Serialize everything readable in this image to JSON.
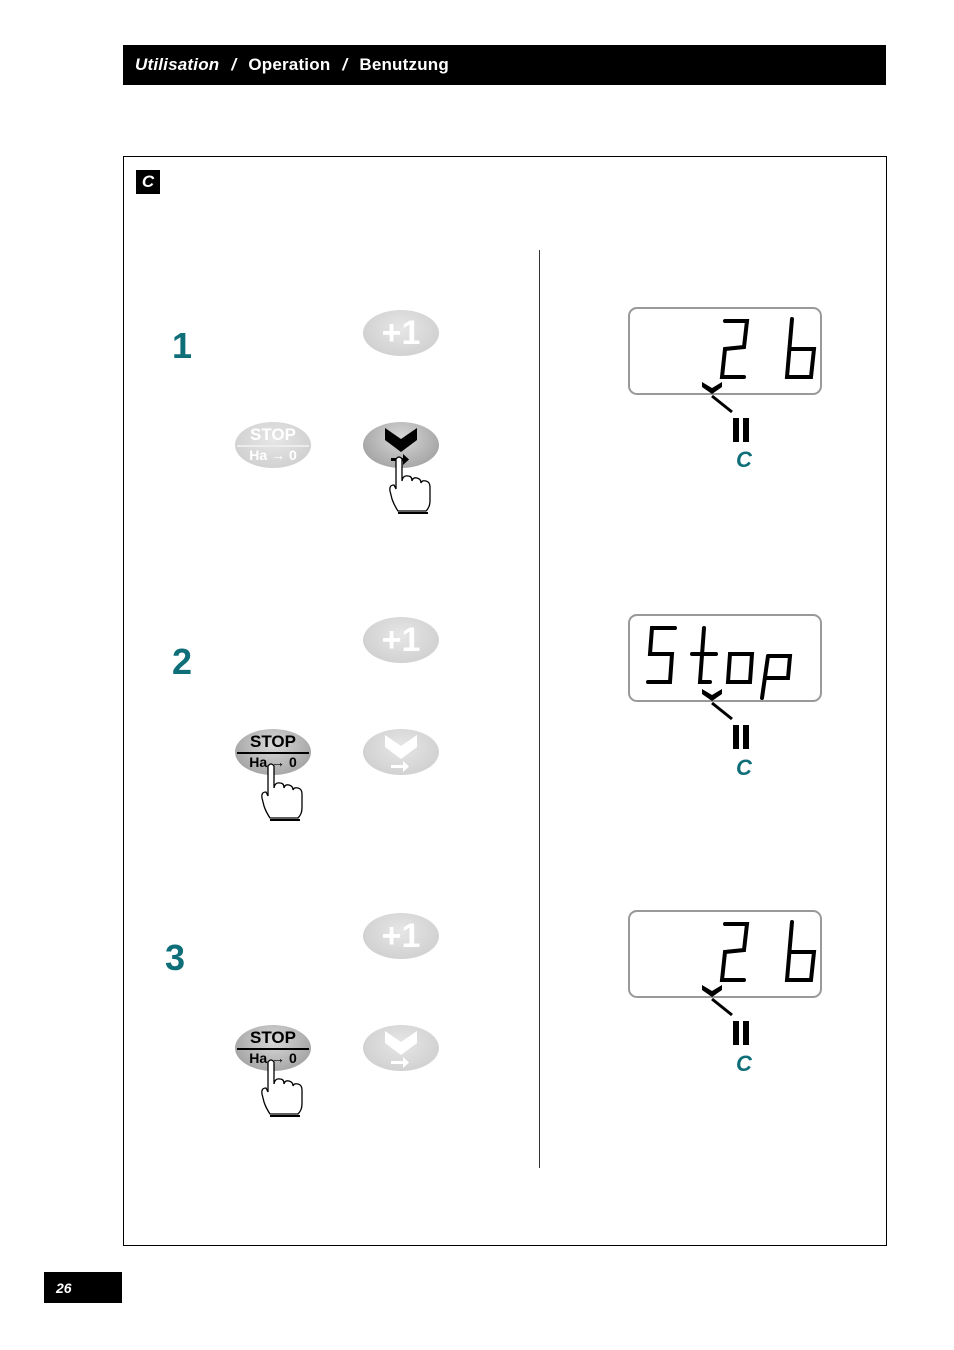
{
  "header": {
    "title_fr": "Utilisation",
    "separator": "/",
    "title_en": "Operation",
    "title_de": "Benutzung"
  },
  "section": {
    "badge": "C"
  },
  "steps": [
    {
      "number": "1",
      "plus_button": {
        "label": "+1",
        "state": "inactive"
      },
      "stop_button": {
        "top_label": "STOP",
        "bottom_label": "Ha → 0",
        "state": "inactive"
      },
      "select_button": {
        "icon": "chevron-down-arrow-icon",
        "state": "pressed"
      },
      "pressed_button": "select",
      "display": {
        "text": "2 b",
        "indicator": "C"
      }
    },
    {
      "number": "2",
      "plus_button": {
        "label": "+1",
        "state": "inactive"
      },
      "stop_button": {
        "top_label": "STOP",
        "bottom_label": "Ha → 0",
        "state": "pressed"
      },
      "select_button": {
        "icon": "chevron-down-arrow-icon",
        "state": "inactive"
      },
      "pressed_button": "stop",
      "display": {
        "text": "Stop",
        "indicator": "C"
      }
    },
    {
      "number": "3",
      "plus_button": {
        "label": "+1",
        "state": "inactive"
      },
      "stop_button": {
        "top_label": "STOP",
        "bottom_label": "Ha → 0",
        "state": "pressed"
      },
      "select_button": {
        "icon": "chevron-down-arrow-icon",
        "state": "inactive"
      },
      "pressed_button": "stop",
      "display": {
        "text": "2 b",
        "indicator": "C"
      }
    }
  ],
  "colors": {
    "accent": "#0f6f78",
    "header_bg": "#000000"
  },
  "footer": {
    "page_number": "26"
  }
}
